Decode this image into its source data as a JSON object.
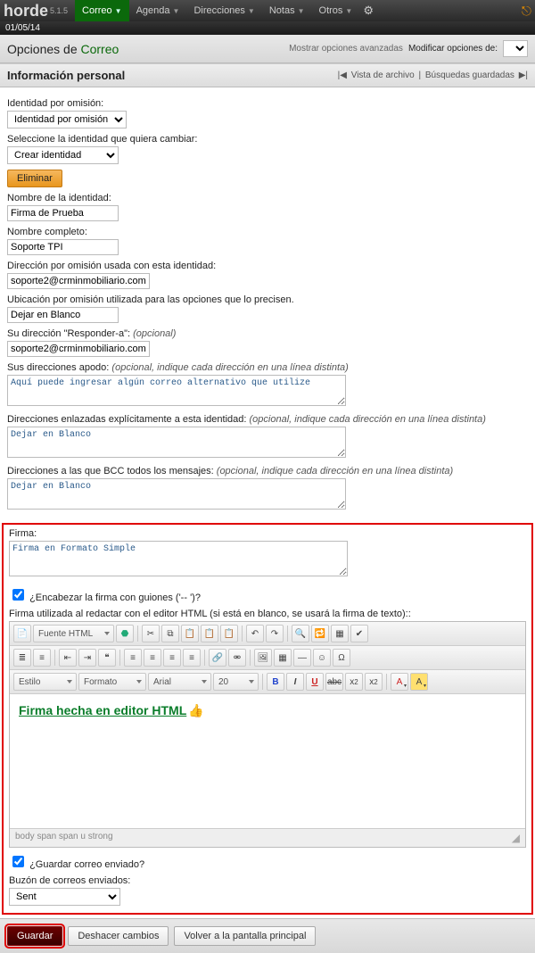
{
  "brand": "horde",
  "version": "5.1.5",
  "date": "01/05/14",
  "menu": {
    "correo": "Correo",
    "agenda": "Agenda",
    "direcciones": "Direcciones",
    "notas": "Notas",
    "otros": "Otros"
  },
  "opts": {
    "title_pre": "Opciones de ",
    "title_app": "Correo",
    "adv": "Mostrar opciones avanzadas",
    "mod": "Modificar opciones de:"
  },
  "hdr": {
    "title": "Información personal",
    "file": "Vista de archivo",
    "saved": "Búsquedas guardadas"
  },
  "f": {
    "lbl_default_identity": "Identidad por omisión:",
    "sel_default_identity": "Identidad por omisión",
    "lbl_select_identity": "Seleccione la identidad que quiera cambiar:",
    "sel_select_identity": "Crear identidad",
    "btn_delete": "Eliminar",
    "lbl_identity_name": "Nombre de la identidad:",
    "val_identity_name": "Firma de Prueba",
    "lbl_fullname": "Nombre completo:",
    "val_fullname": "Soporte TPI",
    "lbl_default_addr": "Dirección por omisión usada con esta identidad:",
    "val_default_addr": "soporte2@crminmobiliario.com",
    "lbl_location": "Ubicación por omisión utilizada para las opciones que lo precisen.",
    "val_location": "Dejar en Blanco",
    "lbl_replyto_pre": "Su dirección \"Responder-a\": ",
    "opt": "(opcional)",
    "val_replyto": "soporte2@crminmobiliario.com",
    "lbl_alias_pre": "Sus direcciones apodo: ",
    "hint_lines": "(opcional, indique cada dirección en una línea distinta)",
    "val_alias": "Aquí puede ingresar algún correo alternativo que utilize",
    "lbl_tieaddr_pre": "Direcciones enlazadas explícitamente a esta identidad: ",
    "val_tieaddr": "Dejar en Blanco",
    "lbl_bcc_pre": "Direcciones a las que BCC todos los mensajes: ",
    "val_bcc": "Dejar en Blanco",
    "lbl_sig": "Firma:",
    "val_sig": "Firma en Formato Simple",
    "lbl_dashes": "¿Encabezar la firma con guiones ('-- ')?",
    "lbl_sightml": "Firma utilizada al redactar con el editor HTML (si está en blanco, se usará la firma de texto)::",
    "lbl_savesent": "¿Guardar correo enviado?",
    "lbl_sentfolder": "Buzón de correos enviados:",
    "val_sentfolder": "Sent"
  },
  "ck": {
    "source": "Fuente HTML",
    "style": "Estilo",
    "format": "Formato",
    "font": "Arial",
    "size": "20",
    "body_text": "Firma hecha en editor HTML",
    "path": "body  span  span  u  strong"
  },
  "btns": {
    "save": "Guardar",
    "undo": "Deshacer cambios",
    "back": "Volver a la pantalla principal"
  }
}
